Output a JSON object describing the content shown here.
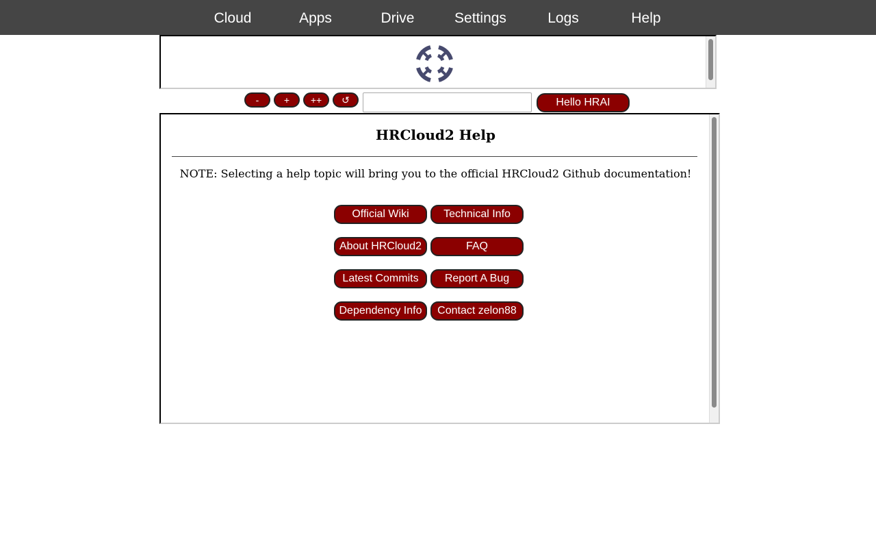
{
  "nav": {
    "items": [
      {
        "label": "Cloud"
      },
      {
        "label": "Apps"
      },
      {
        "label": "Drive"
      },
      {
        "label": "Settings"
      },
      {
        "label": "Logs"
      },
      {
        "label": "Help"
      }
    ]
  },
  "logo": {
    "icon": "hrcloud-logo-icon",
    "color": "#474a6e"
  },
  "toolbar": {
    "zoom_out_label": "-",
    "zoom_in_label": "+",
    "zoom_in_more_label": "++",
    "refresh_label": "↺",
    "input_value": "",
    "hello_label": "Hello HRAI"
  },
  "help": {
    "title": "HRCloud2 Help",
    "note": "NOTE: Selecting a help topic will bring you to the official HRCloud2 Github documentation!",
    "buttons": [
      {
        "label": "Official Wiki"
      },
      {
        "label": "Technical Info"
      },
      {
        "label": "About HRCloud2"
      },
      {
        "label": "FAQ"
      },
      {
        "label": "Latest Commits"
      },
      {
        "label": "Report A Bug"
      },
      {
        "label": "Dependency Info"
      },
      {
        "label": "Contact zelon88"
      }
    ]
  },
  "colors": {
    "nav_bg": "#454545",
    "button_bg": "#8b0000",
    "button_text": "#ffffff"
  }
}
